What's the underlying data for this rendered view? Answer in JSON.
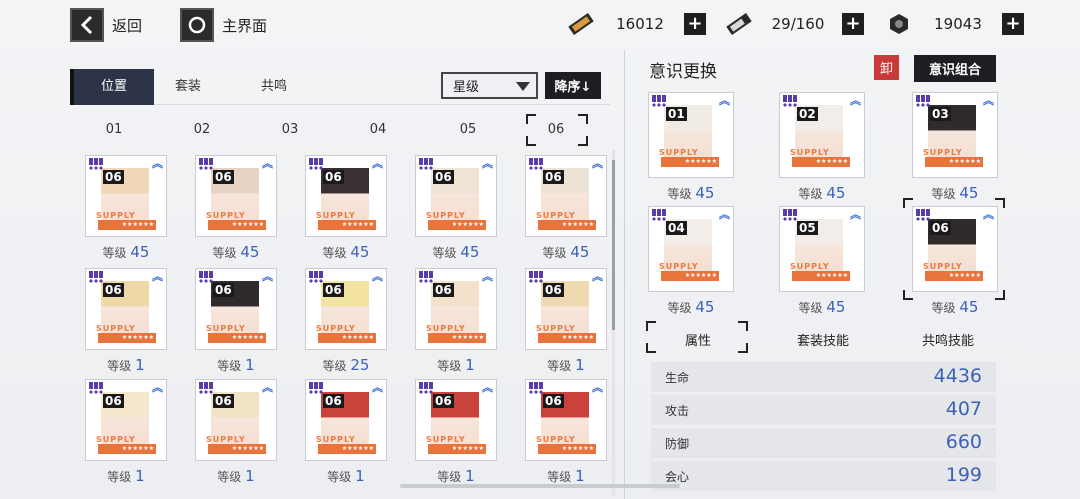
{
  "nav": {
    "back_label": "返回",
    "home_label": "主界面"
  },
  "resources": [
    {
      "icon": "ticket-icon",
      "value": "16012"
    },
    {
      "icon": "battery-icon",
      "value": "29/160"
    },
    {
      "icon": "hex-coin-icon",
      "value": "19043"
    }
  ],
  "left_tabs": [
    {
      "label": "位置"
    },
    {
      "label": "套装"
    },
    {
      "label": "共鸣"
    }
  ],
  "filter": {
    "selected": "星级",
    "sort_label": "降序↓"
  },
  "positions": [
    "01",
    "02",
    "03",
    "04",
    "05",
    "06"
  ],
  "level_label": "等级",
  "supply_text": "SUPPLY",
  "inventory": [
    {
      "slot": "06",
      "level": "45"
    },
    {
      "slot": "06",
      "level": "45"
    },
    {
      "slot": "06",
      "level": "45"
    },
    {
      "slot": "06",
      "level": "45"
    },
    {
      "slot": "06",
      "level": "45"
    },
    {
      "slot": "06",
      "level": "1"
    },
    {
      "slot": "06",
      "level": "1"
    },
    {
      "slot": "06",
      "level": "25"
    },
    {
      "slot": "06",
      "level": "1"
    },
    {
      "slot": "06",
      "level": "1"
    },
    {
      "slot": "06",
      "level": "1"
    },
    {
      "slot": "06",
      "level": "1"
    },
    {
      "slot": "06",
      "level": "1"
    },
    {
      "slot": "06",
      "level": "1"
    },
    {
      "slot": "06",
      "level": "1"
    }
  ],
  "right_panel": {
    "title": "意识更换",
    "unequip_label": "卸",
    "combo_label": "意识组合",
    "equipped": [
      {
        "slot": "01",
        "level": "45"
      },
      {
        "slot": "02",
        "level": "45"
      },
      {
        "slot": "03",
        "level": "45"
      },
      {
        "slot": "04",
        "level": "45"
      },
      {
        "slot": "05",
        "level": "45"
      },
      {
        "slot": "06",
        "level": "45"
      }
    ],
    "sub_tabs": [
      {
        "label": "属性"
      },
      {
        "label": "套装技能"
      },
      {
        "label": "共鸣技能"
      }
    ],
    "stats": [
      {
        "name": "生命",
        "value": "4436"
      },
      {
        "name": "攻击",
        "value": "407"
      },
      {
        "name": "防御",
        "value": "660"
      },
      {
        "name": "会心",
        "value": "199"
      }
    ]
  },
  "colors": {
    "accent_blue": "#3c62b8",
    "supply_orange": "#e8733b",
    "dark": "#1d1e22",
    "unequip_red": "#c93a3a"
  }
}
